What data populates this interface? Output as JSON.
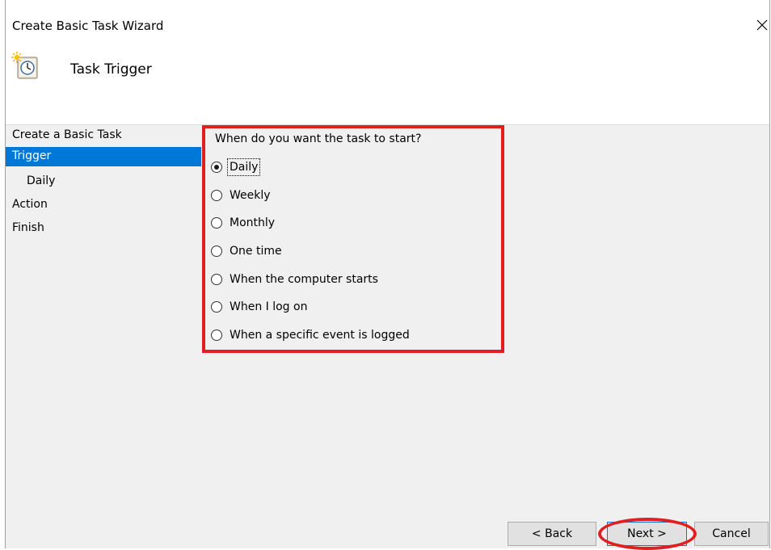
{
  "window": {
    "title": "Create Basic Task Wizard",
    "close_icon": "close-icon",
    "task_icon": "scheduled-task-clock-icon"
  },
  "header": {
    "heading": "Task Trigger"
  },
  "sidebar": {
    "items": [
      {
        "label": "Create a Basic Task",
        "selected": false,
        "sub": false
      },
      {
        "label": "Trigger",
        "selected": true,
        "sub": false
      },
      {
        "label": "Daily",
        "selected": false,
        "sub": true
      },
      {
        "label": "Action",
        "selected": false,
        "sub": false
      },
      {
        "label": "Finish",
        "selected": false,
        "sub": false
      }
    ]
  },
  "trigger": {
    "question": "When do you want the task to start?",
    "options": [
      {
        "label": "Daily",
        "checked": true
      },
      {
        "label": "Weekly",
        "checked": false
      },
      {
        "label": "Monthly",
        "checked": false
      },
      {
        "label": "One time",
        "checked": false
      },
      {
        "label": "When the computer starts",
        "checked": false
      },
      {
        "label": "When I log on",
        "checked": false
      },
      {
        "label": "When a specific event is logged",
        "checked": false
      }
    ]
  },
  "buttons": {
    "back": "< Back",
    "next": "Next >",
    "cancel": "Cancel"
  },
  "colors": {
    "selection": "#0078d7",
    "annotation": "#e02020",
    "panel_bg": "#f0f0f0"
  }
}
